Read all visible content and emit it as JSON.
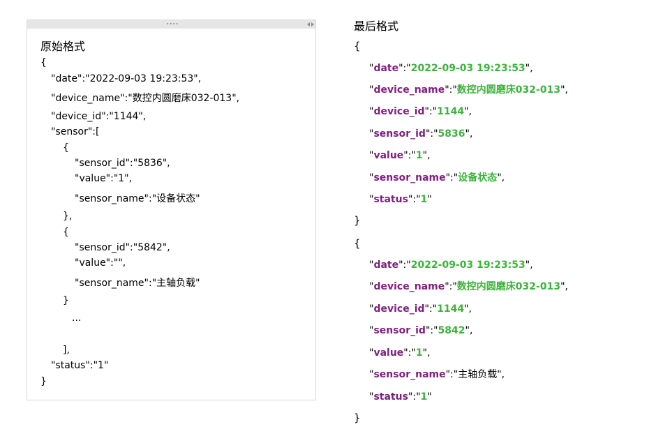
{
  "original": {
    "title": "原始格式",
    "lines": [
      "{",
      "\"date\":\"2022-09-03 19:23:53\",",
      "\"device_name\":\"数控内圆磨床032-013\",",
      "\"device_id\":\"1144\",",
      "\"sensor\":[",
      "{",
      "\"sensor_id\":\"5836\",",
      "\"value\":\"1\",",
      "\"sensor_name\":\"设备状态\"",
      "},",
      "{",
      "\"sensor_id\":\"5842\",",
      "\"value\":\"\",",
      "\"sensor_name\":\"主轴负载\"",
      "}",
      "...",
      "],",
      "\"status\":\"1\"",
      "}"
    ]
  },
  "final": {
    "title": "最后格式",
    "open_brace": "{",
    "close_brace": "}",
    "records": [
      [
        {
          "key": "date",
          "value": "2022-09-03 19:23:53",
          "comma": ","
        },
        {
          "key": "device_name",
          "value": "数控内圆磨床032-013",
          "comma": ","
        },
        {
          "key": "device_id",
          "value": "1144",
          "comma": ","
        },
        {
          "key": "sensor_id",
          "value": "5836",
          "comma": ","
        },
        {
          "key": "value",
          "value": "1",
          "comma": ","
        },
        {
          "key": "sensor_name",
          "value": "设备状态",
          "comma": ","
        },
        {
          "key": "status",
          "value": "1",
          "comma": ""
        }
      ],
      [
        {
          "key": "date",
          "value": "2022-09-03 19:23:53",
          "comma": ","
        },
        {
          "key": "device_name",
          "value": "数控内圆磨床032-013",
          "comma": ","
        },
        {
          "key": "device_id",
          "value": "1144",
          "comma": ","
        },
        {
          "key": "sensor_id",
          "value": "5842",
          "comma": ","
        },
        {
          "key": "value",
          "value": "1",
          "comma": ","
        },
        {
          "key": "sensor_name",
          "value": "主轴负载",
          "comma": ",",
          "value_plain": true
        },
        {
          "key": "status",
          "value": "1",
          "comma": ""
        }
      ]
    ]
  },
  "colors": {
    "key": "#7e1f7e",
    "value": "#3cb33c",
    "panel_border": "#d9d9d9",
    "panel_bar": "#e6e6e6"
  }
}
